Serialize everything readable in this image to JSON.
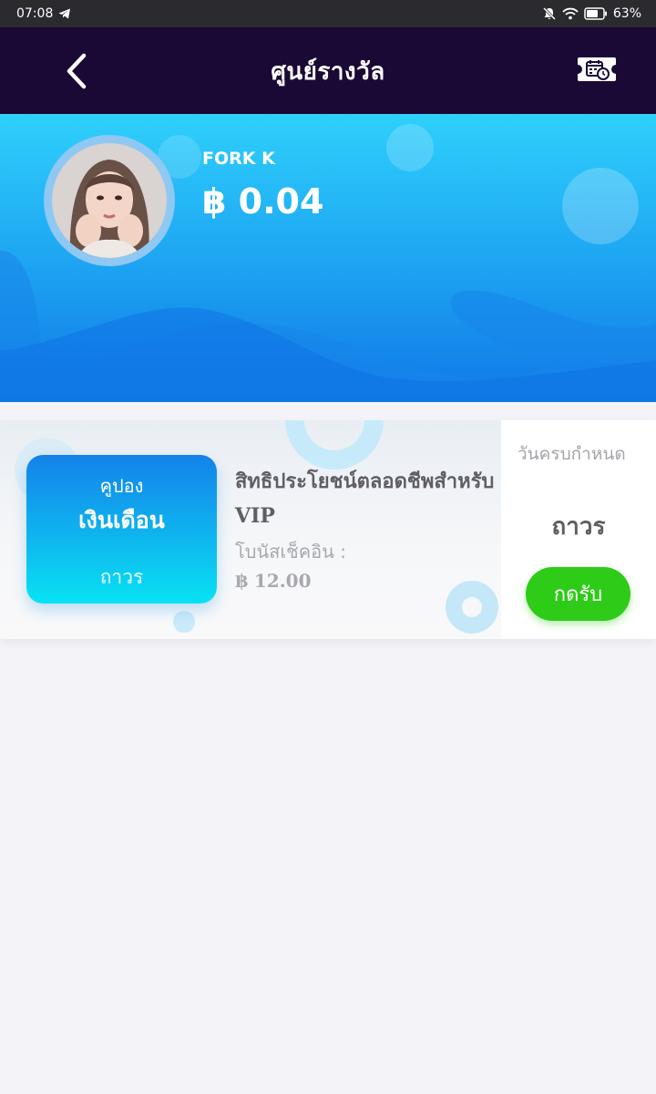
{
  "status_bar": {
    "time": "07:08",
    "battery": "63%",
    "icons": [
      "telegram-icon",
      "mute-icon",
      "wifi-icon",
      "battery-icon"
    ]
  },
  "header": {
    "title": "ศูนย์รางวัล",
    "back_icon": "chevron-left-icon",
    "action_icon": "ticket-calendar-icon",
    "background": "#1a0935"
  },
  "profile": {
    "name": "FORK K",
    "balance": "฿ 0.04"
  },
  "coupon": {
    "badge_top": "คูปอง",
    "badge_main": "เงินเดือน",
    "badge_bottom": "ถาวร",
    "title": "สิทธิประโยชน์ตลอดชีพสำหรับ VIP",
    "bonus_label": "โบนัสเช็คอิน :",
    "bonus_value": "฿ 12.00",
    "expiry_label": "วันครบกำหนด",
    "expiry_value": "ถาวร",
    "claim_label": "กดรับ",
    "claim_color": "#2ecb18"
  }
}
